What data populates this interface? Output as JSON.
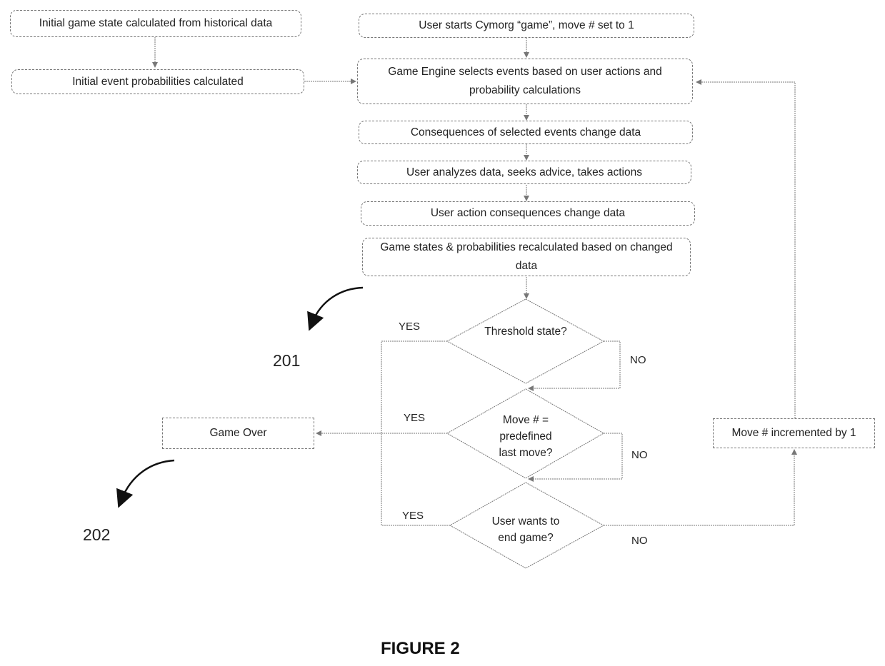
{
  "figure": {
    "caption": "FIGURE 2",
    "reference_numerals": [
      "201",
      "202"
    ]
  },
  "nodes": {
    "initial_state": "Initial game state calculated from historical data",
    "initial_probabilities": "Initial event probabilities calculated",
    "user_starts": "User starts Cymorg “game”, move # set to 1",
    "engine_selects": "Game Engine selects events based on user actions and probability calculations",
    "consequences_events": "Consequences of selected events change data",
    "user_analyzes": "User analyzes data, seeks advice, takes actions",
    "user_action_consequences": "User action consequences change data",
    "recalculated": "Game states & probabilities recalculated based on changed data",
    "game_over": "Game Over",
    "move_incremented": "Move # incremented by 1"
  },
  "decisions": {
    "threshold": "Threshold state?",
    "last_move_line1": "Move # =",
    "last_move_line2": "predefined",
    "last_move_line3": "last move?",
    "end_game_line1": "User wants to",
    "end_game_line2": "end game?"
  },
  "branch_labels": {
    "yes": "YES",
    "no": "NO"
  },
  "colors": {
    "line": "#777777",
    "callout_arrow": "#111111",
    "text": "#222222"
  }
}
